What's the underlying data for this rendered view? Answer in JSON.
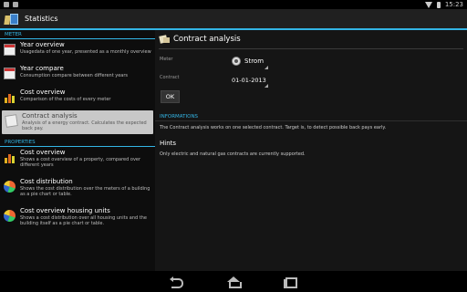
{
  "status_bar": {
    "time": "15:23"
  },
  "action_bar": {
    "title": "Statistics"
  },
  "left": {
    "meter_header": "METER",
    "meter_items": [
      {
        "title": "Year overview",
        "desc": "Usagedata of one year, presented as a monthly overview",
        "icon": "calendar-icon"
      },
      {
        "title": "Year compare",
        "desc": "Consumption compare between different years",
        "icon": "calendar-icon"
      },
      {
        "title": "Cost overview",
        "desc": "Comparison of the costs of every meter",
        "icon": "bar-chart-icon"
      },
      {
        "title": "Contract analysis",
        "desc": "Analysis of a energy contract. Calculates the expected back pay.",
        "icon": "note-icon",
        "selected": true
      }
    ],
    "properties_header": "PROPERTIES",
    "property_items": [
      {
        "title": "Cost overview",
        "desc": "Shows a cost overview of a property, compared over different years",
        "icon": "bar-chart-icon"
      },
      {
        "title": "Cost distribution",
        "desc": "Shows the cost distribution over the meters of a building as a pie chart or table.",
        "icon": "pie-chart-icon"
      },
      {
        "title": "Cost overview housing units",
        "desc": "Shows a cost distribution over all housing units and the building itself as a pie chart or table.",
        "icon": "pie-chart-icon"
      }
    ]
  },
  "right": {
    "title": "Contract analysis",
    "meter_label": "Meter",
    "meter_value": "Strom",
    "contract_label": "Contract",
    "contract_value": "01-01-2013",
    "ok_label": "OK",
    "info_header": "INFORMATIONS",
    "info_text": "The Contract analysis works on one selected contract. Target is, to detect possible back pays early.",
    "hints_title": "Hints",
    "hints_text": "Only electric and natural gas contracts are currently supported."
  },
  "colors": {
    "accent": "#33b5e5",
    "selected_bg": "#c8c8c8"
  }
}
